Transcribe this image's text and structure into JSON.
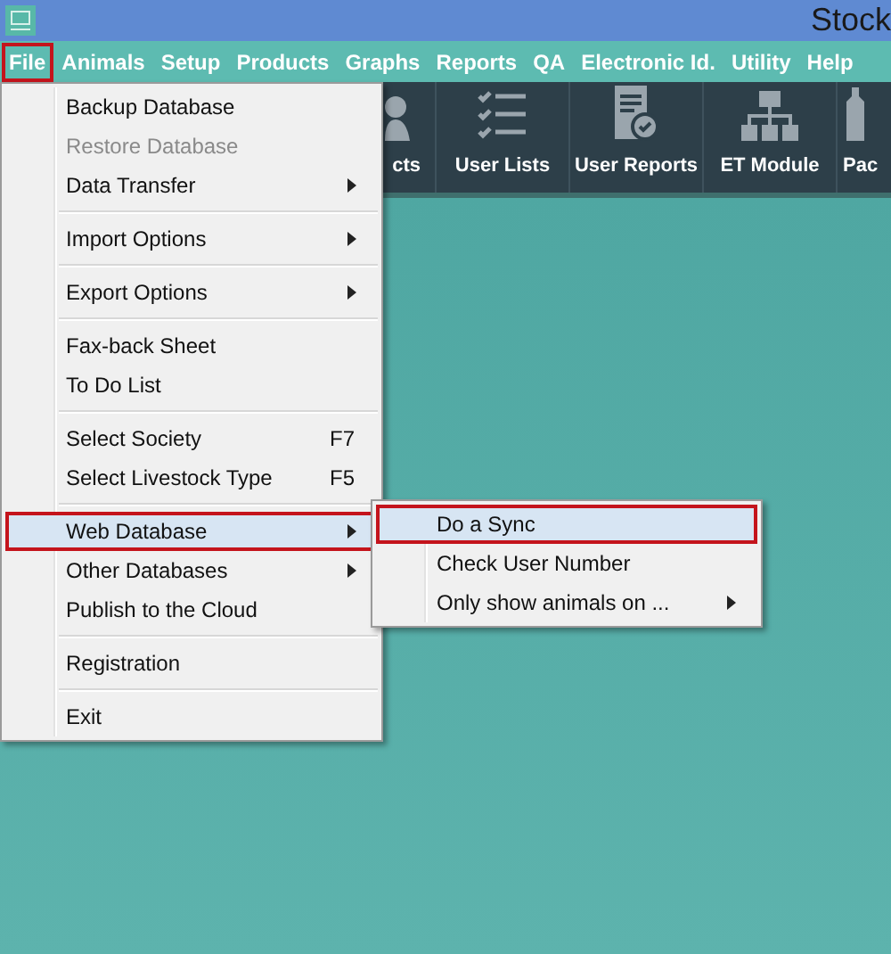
{
  "title_bar": {
    "title": "Stock"
  },
  "menu_bar": [
    {
      "label": "File",
      "selected": true
    },
    {
      "label": "Animals",
      "selected": false
    },
    {
      "label": "Setup",
      "selected": false
    },
    {
      "label": "Products",
      "selected": false
    },
    {
      "label": "Graphs",
      "selected": false
    },
    {
      "label": "Reports",
      "selected": false
    },
    {
      "label": "QA",
      "selected": false
    },
    {
      "label": "Electronic Id.",
      "selected": false
    },
    {
      "label": "Utility",
      "selected": false
    },
    {
      "label": "Help",
      "selected": false
    }
  ],
  "toolbar": [
    {
      "label": "cts"
    },
    {
      "label": "User Lists"
    },
    {
      "label": "User Reports"
    },
    {
      "label": "ET Module"
    },
    {
      "label": "Pac"
    }
  ],
  "file_menu": [
    {
      "kind": "item",
      "label": "Backup Database",
      "disabled": false,
      "selected": false,
      "has_submenu": false
    },
    {
      "kind": "item",
      "label": "Restore Database",
      "disabled": true,
      "selected": false,
      "has_submenu": false
    },
    {
      "kind": "item",
      "label": "Data Transfer",
      "disabled": false,
      "selected": false,
      "has_submenu": true
    },
    {
      "kind": "separator"
    },
    {
      "kind": "item",
      "label": "Import Options",
      "disabled": false,
      "selected": false,
      "has_submenu": true
    },
    {
      "kind": "separator"
    },
    {
      "kind": "item",
      "label": "Export Options",
      "disabled": false,
      "selected": false,
      "has_submenu": true
    },
    {
      "kind": "separator"
    },
    {
      "kind": "item",
      "label": "Fax-back Sheet",
      "disabled": false,
      "selected": false,
      "has_submenu": false
    },
    {
      "kind": "item",
      "label": "To Do List",
      "disabled": false,
      "selected": false,
      "has_submenu": false
    },
    {
      "kind": "separator"
    },
    {
      "kind": "item",
      "label": "Select Society",
      "shortcut": "F7",
      "disabled": false,
      "selected": false,
      "has_submenu": false
    },
    {
      "kind": "item",
      "label": "Select Livestock Type",
      "shortcut": "F5",
      "disabled": false,
      "selected": false,
      "has_submenu": false
    },
    {
      "kind": "separator"
    },
    {
      "kind": "item",
      "label": "Web Database",
      "disabled": false,
      "selected": true,
      "has_submenu": true
    },
    {
      "kind": "item",
      "label": "Other Databases",
      "disabled": false,
      "selected": false,
      "has_submenu": true
    },
    {
      "kind": "item",
      "label": "Publish to the Cloud",
      "disabled": false,
      "selected": false,
      "has_submenu": false
    },
    {
      "kind": "separator"
    },
    {
      "kind": "item",
      "label": "Registration",
      "disabled": false,
      "selected": false,
      "has_submenu": false
    },
    {
      "kind": "separator"
    },
    {
      "kind": "item",
      "label": "Exit",
      "disabled": false,
      "selected": false,
      "has_submenu": false
    }
  ],
  "web_database_submenu": [
    {
      "kind": "item",
      "label": "Do a Sync",
      "disabled": false,
      "selected": true,
      "has_submenu": false
    },
    {
      "kind": "item",
      "label": "Check User Number",
      "disabled": false,
      "selected": false,
      "has_submenu": false
    },
    {
      "kind": "item",
      "label": "Only show animals on ...",
      "disabled": false,
      "selected": false,
      "has_submenu": true
    }
  ]
}
